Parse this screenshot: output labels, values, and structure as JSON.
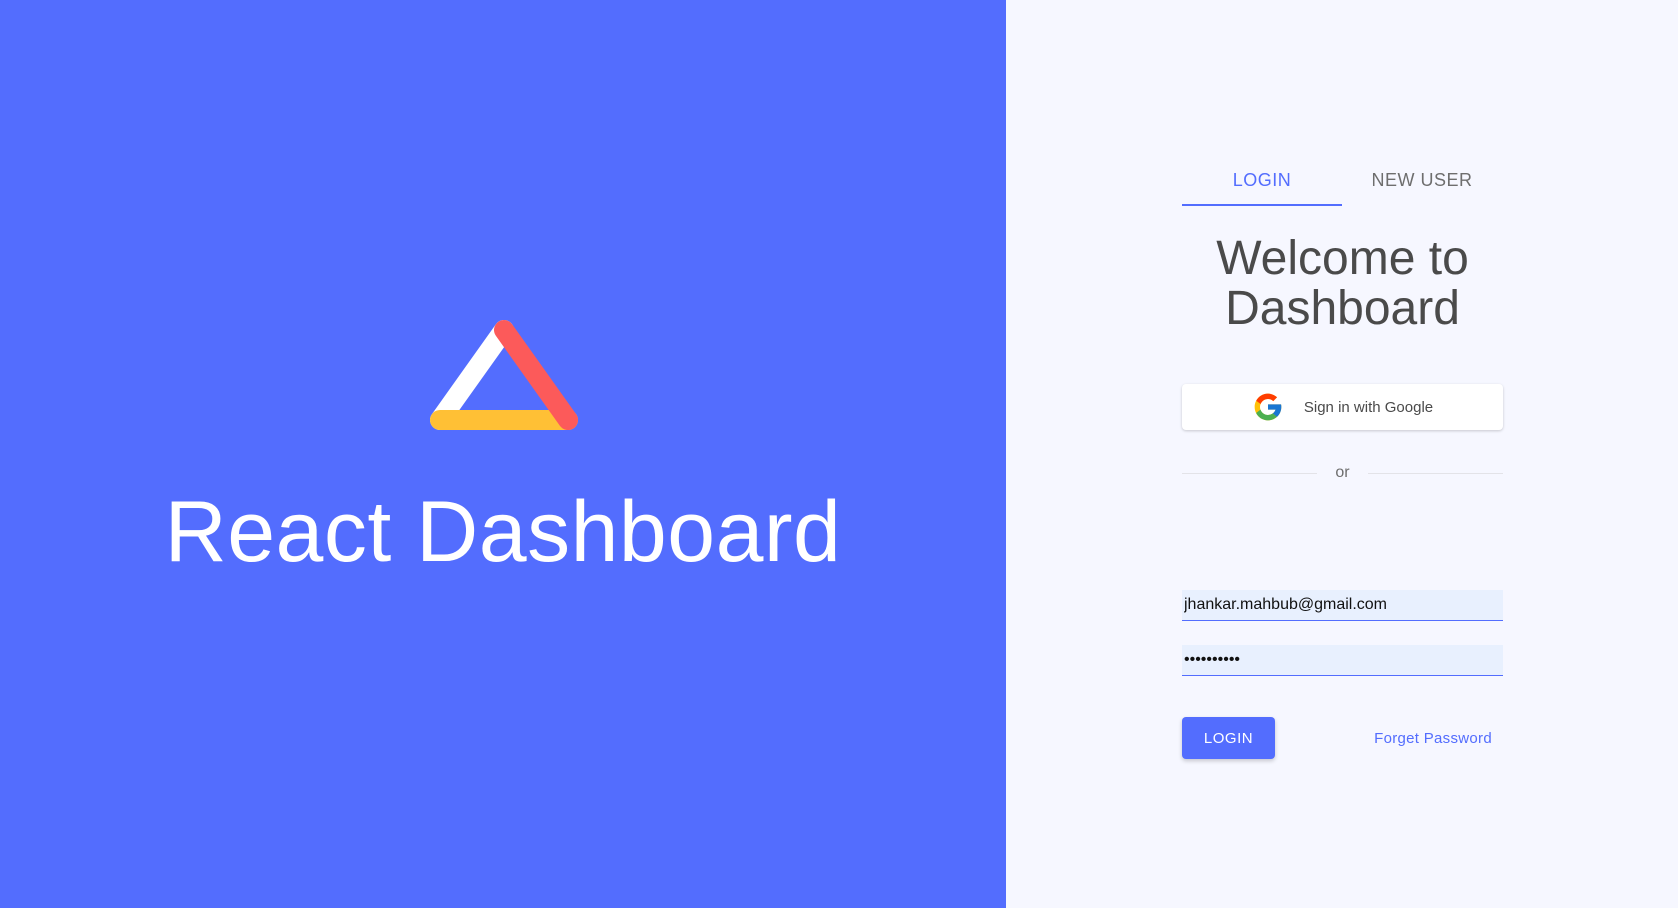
{
  "left_panel": {
    "brand_title": "React Dashboard",
    "background_color": "#536dfe",
    "logo": {
      "icon": "triangle-logo-icon",
      "colors": [
        "#ffffff",
        "#fc5a5a",
        "#ffc035"
      ]
    }
  },
  "tabs": [
    {
      "label": "LOGIN",
      "active": true
    },
    {
      "label": "NEW USER",
      "active": false
    }
  ],
  "welcome_text": "Welcome to Dashboard",
  "google_button": {
    "label": "Sign in with Google",
    "icon": "google-icon"
  },
  "divider_text": "or",
  "form": {
    "email_value": "jhankar.mahbub@gmail.com",
    "password_value": "••••••••••"
  },
  "actions": {
    "login_label": "LOGIN",
    "forget_label": "Forget Password"
  },
  "colors": {
    "accent": "#536dfe",
    "right_background": "#f6f7ff",
    "text": "#4a4a4a"
  }
}
